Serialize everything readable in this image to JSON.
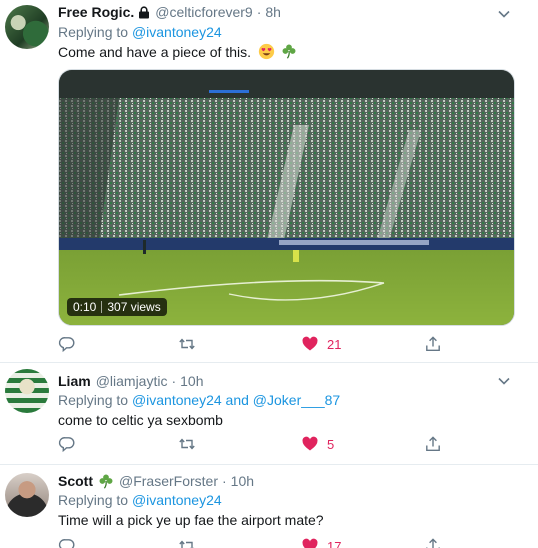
{
  "tweets": [
    {
      "name": "Free Rogic.",
      "handle": "@celticforever9",
      "time": "8h",
      "replying_prefix": "Replying to ",
      "mentions": [
        "@ivantoney24"
      ],
      "text": "Come and have a piece of this.",
      "video": {
        "duration": "0:10",
        "views": "307 views"
      },
      "likes": "21"
    },
    {
      "name": "Liam",
      "handle": "@liamjaytic",
      "time": "10h",
      "replying_prefix": "Replying to ",
      "mentions": [
        "@ivantoney24",
        "@Joker___87"
      ],
      "mention_joiner": " and ",
      "text": "come to celtic ya sexbomb",
      "likes": "5"
    },
    {
      "name": "Scott",
      "handle": "@FraserForster",
      "time": "10h",
      "replying_prefix": "Replying to ",
      "mentions": [
        "@ivantoney24"
      ],
      "text": "Time will a pick ye up fae the airport mate?",
      "likes": "17"
    }
  ],
  "colors": {
    "link": "#1b95e0",
    "secondary": "#657786",
    "like_red": "#e0245e",
    "divider": "#e6ecf0"
  },
  "icons": [
    "lock-icon",
    "smiling-face-heart-eyes-icon",
    "shamrock-icon",
    "chevron-down-icon",
    "reply-icon",
    "retweet-icon",
    "like-heart-icon",
    "share-icon"
  ]
}
